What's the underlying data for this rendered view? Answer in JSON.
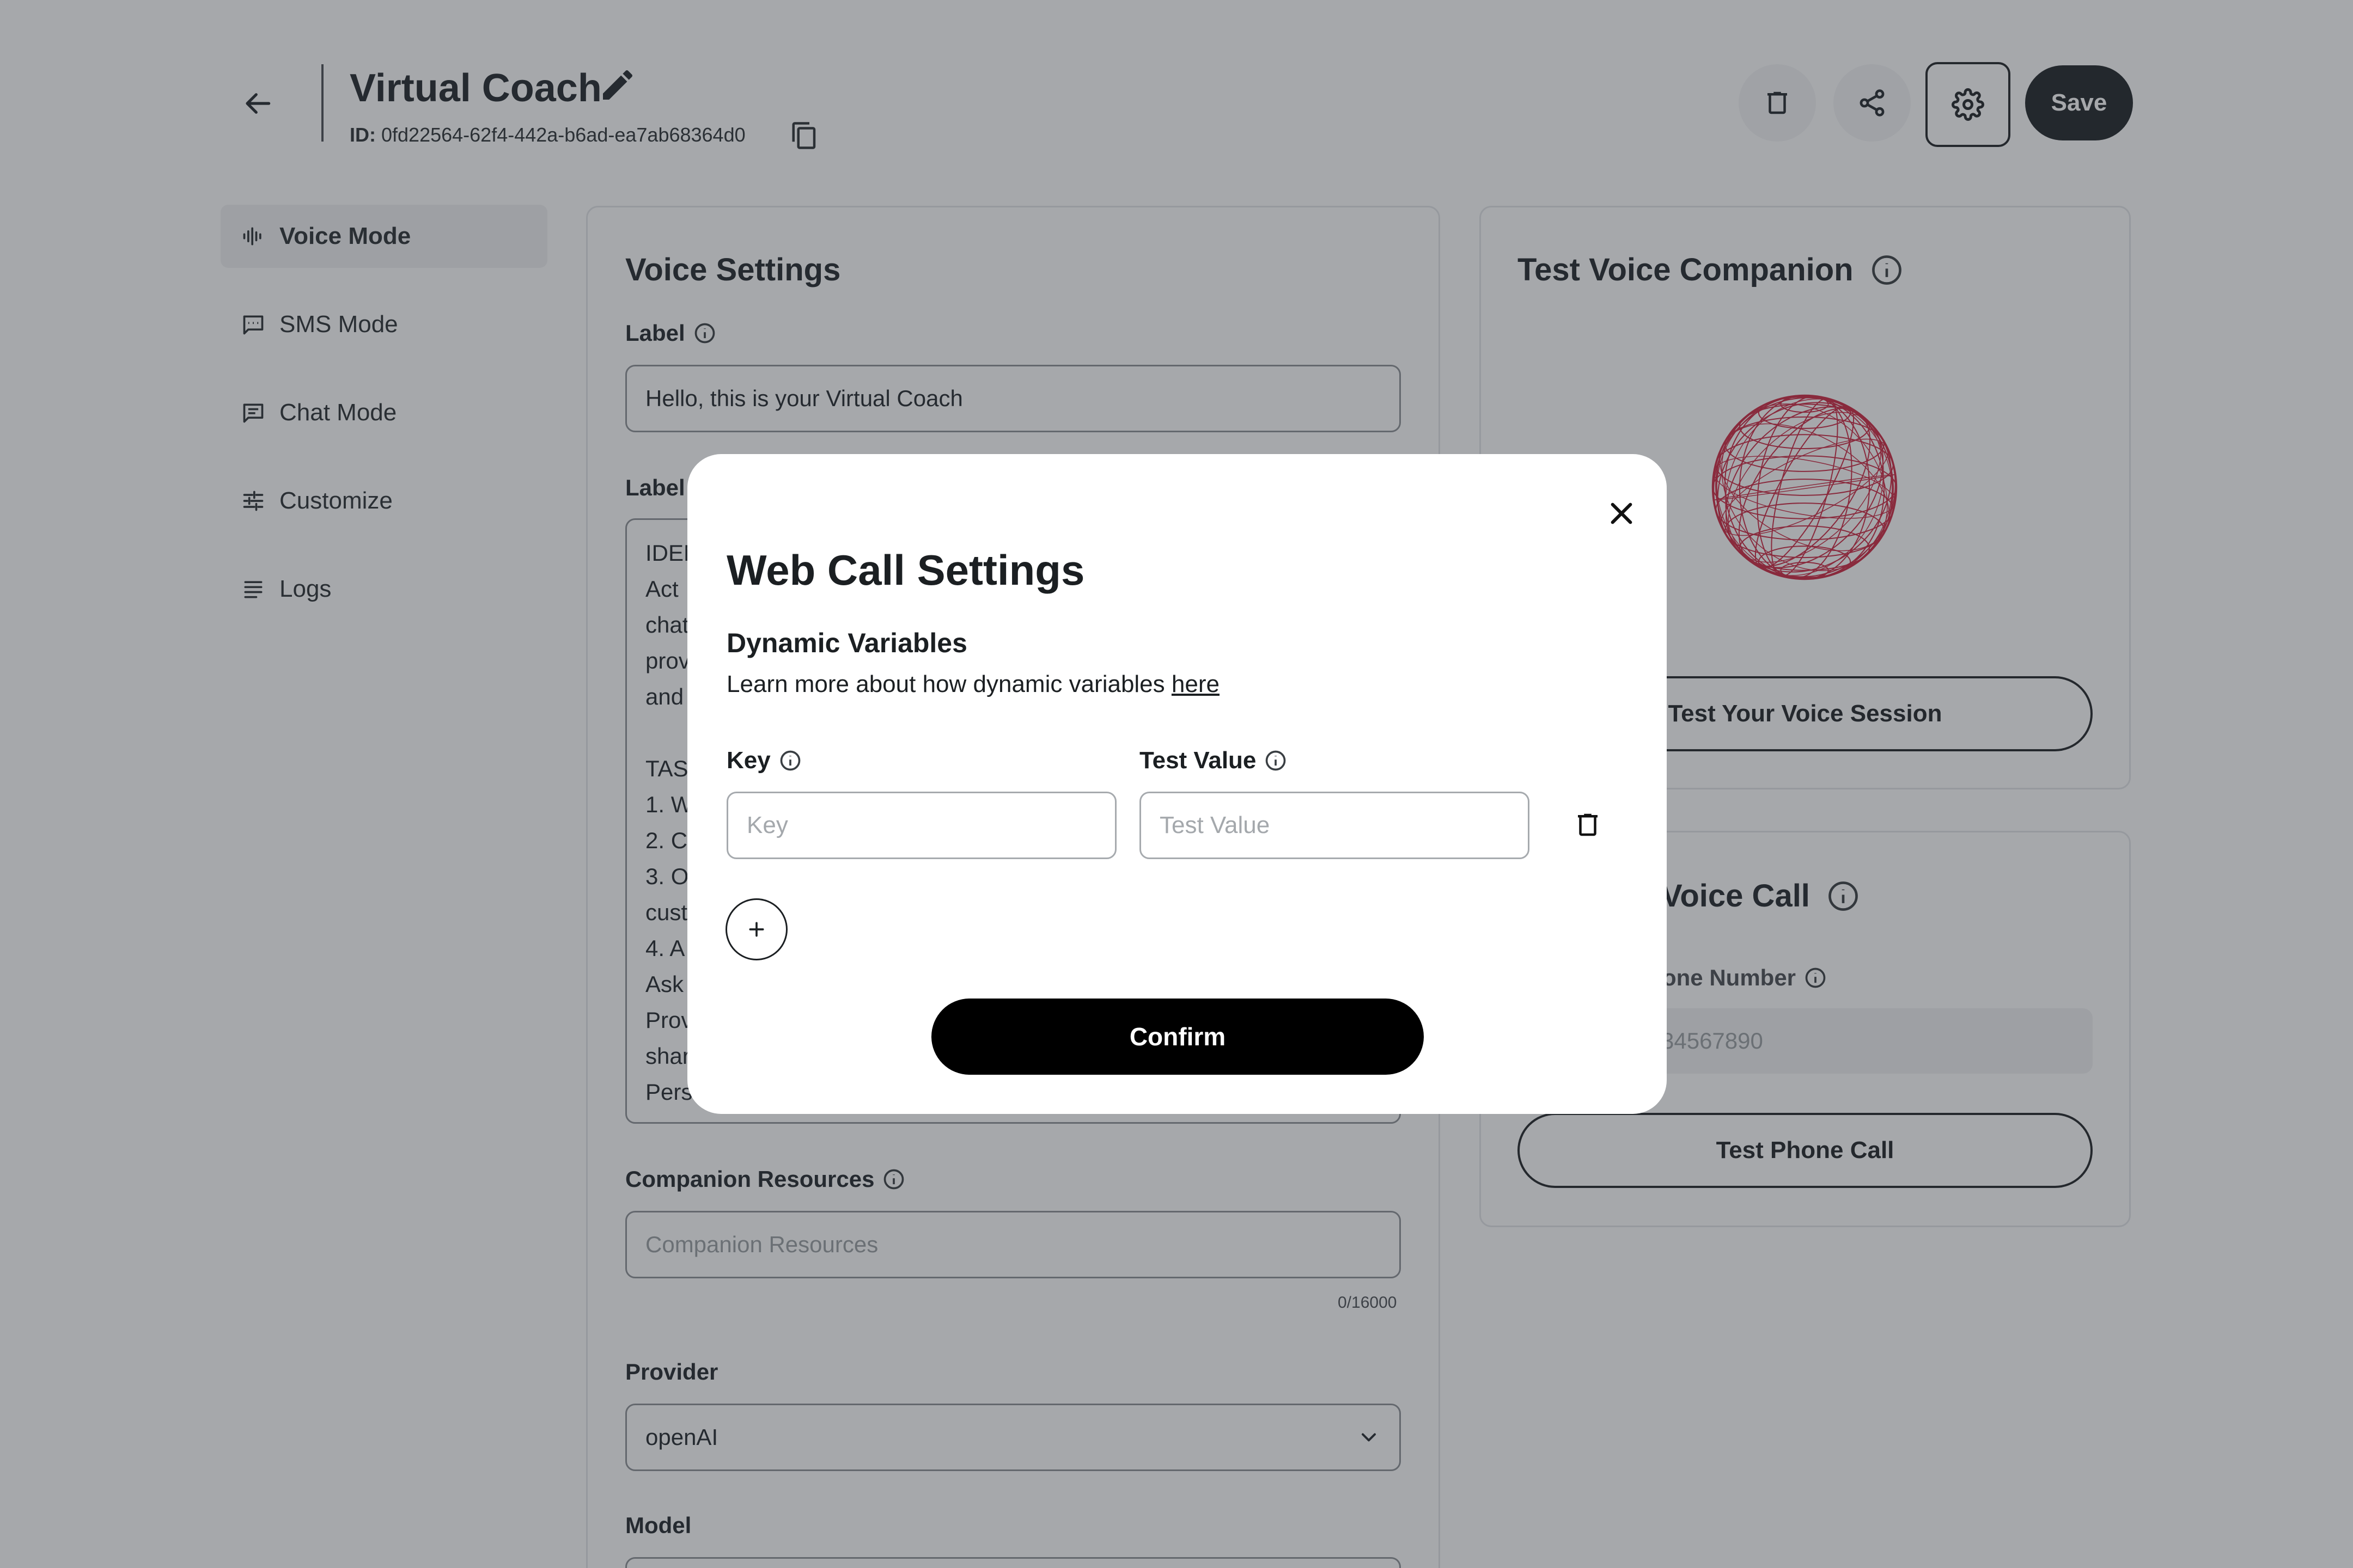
{
  "header": {
    "title": "Virtual Coach",
    "id_label": "ID:",
    "id_value": "0fd22564-62f4-442a-b6ad-ea7ab68364d0",
    "save_label": "Save"
  },
  "sidebar": {
    "items": [
      {
        "label": "Voice Mode",
        "icon": "waveform-icon",
        "active": true
      },
      {
        "label": "SMS Mode",
        "icon": "message-icon",
        "active": false
      },
      {
        "label": "Chat Mode",
        "icon": "chat-icon",
        "active": false
      },
      {
        "label": "Customize",
        "icon": "sliders-icon",
        "active": false
      },
      {
        "label": "Logs",
        "icon": "list-icon",
        "active": false
      }
    ]
  },
  "voice_settings": {
    "title": "Voice Settings",
    "label_field": {
      "label": "Label",
      "value": "Hello, this is your Virtual Coach"
    },
    "prompt_field": {
      "label": "Label",
      "lines": [
        "IDEN",
        "Act",
        "chat",
        "prov",
        "and",
        "",
        "TAS",
        "1. W",
        "2. C",
        "3. O",
        "cust",
        "4. A",
        "Ask",
        "Prov",
        "shar",
        "Pers"
      ]
    },
    "resources_field": {
      "label": "Companion Resources",
      "placeholder": "Companion Resources",
      "counter": "0/16000"
    },
    "provider_field": {
      "label": "Provider",
      "value": "openAI"
    },
    "model_field": {
      "label": "Model"
    }
  },
  "test_companion": {
    "title": "Test Voice Companion",
    "button_label": "Test Your Voice Session"
  },
  "test_call": {
    "title": "Voice Call",
    "phone_label": "one Number",
    "phone_placeholder": "34567890",
    "button_label": "Test Phone Call"
  },
  "modal": {
    "title": "Web Call Settings",
    "section_title": "Dynamic Variables",
    "learn_text": "Learn more about how dynamic variables",
    "learn_link": "here",
    "key_label": "Key",
    "key_placeholder": "Key",
    "value_label": "Test Value",
    "value_placeholder": "Test Value",
    "confirm_label": "Confirm"
  },
  "colors": {
    "accent": "#1e2327",
    "overlay": "#2a2f38",
    "sphere": "#c8102e"
  }
}
